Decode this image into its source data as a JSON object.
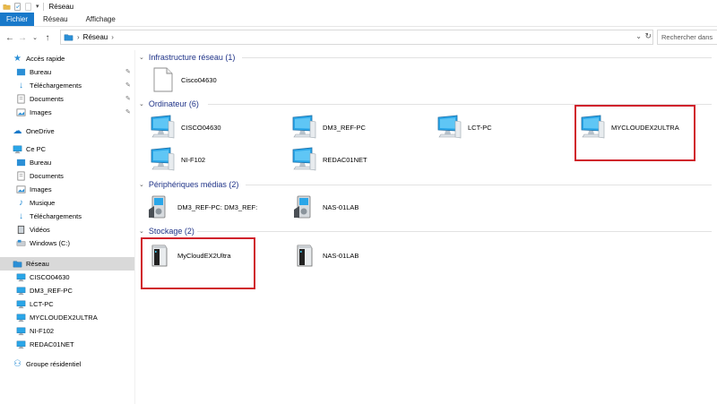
{
  "window": {
    "title": "Réseau"
  },
  "ribbon": {
    "tabs": [
      "Fichier",
      "Réseau",
      "Affichage"
    ]
  },
  "address": {
    "path": "Réseau",
    "search_placeholder": "Rechercher dans"
  },
  "nav": {
    "quick_access": "Accès rapide",
    "quick_items": [
      "Bureau",
      "Téléchargements",
      "Documents",
      "Images"
    ],
    "onedrive": "OneDrive",
    "this_pc": "Ce PC",
    "pc_items": [
      "Bureau",
      "Documents",
      "Images",
      "Musique",
      "Téléchargements",
      "Vidéos",
      "Windows (C:)"
    ],
    "network": "Réseau",
    "network_items": [
      "CISCO04630",
      "DM3_REF-PC",
      "LCT-PC",
      "MYCLOUDEX2ULTRA",
      "NI-F102",
      "REDAC01NET"
    ],
    "homegroup": "Groupe résidentiel"
  },
  "groups": {
    "infra": {
      "header": "Infrastructure réseau (1)",
      "items": [
        "Cisco04630"
      ]
    },
    "computers": {
      "header": "Ordinateur (6)",
      "items": [
        "CISCO04630",
        "DM3_REF-PC",
        "LCT-PC",
        "MYCLOUDEX2ULTRA",
        "NI-F102",
        "REDAC01NET"
      ]
    },
    "media": {
      "header": "Périphériques médias (2)",
      "items": [
        "DM3_REF-PC: DM3_REF:",
        "NAS-01LAB"
      ]
    },
    "storage": {
      "header": "Stockage (2)",
      "items": [
        "MyCloudEX2Ultra",
        "NAS-01LAB"
      ]
    }
  },
  "colors": {
    "accent": "#1979ca",
    "header_text": "#1e3287",
    "highlight_box": "#d0202b",
    "selected_bg": "#d9d9d9"
  }
}
